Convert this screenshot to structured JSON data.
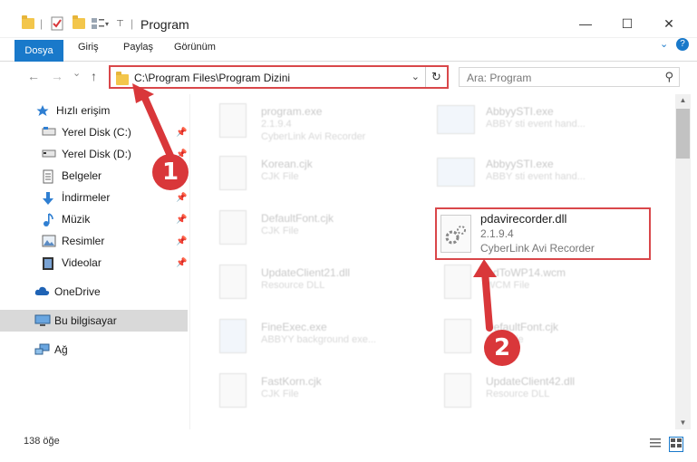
{
  "window": {
    "title": "Program",
    "minimize": "—",
    "maximize": "☐",
    "close": "✕"
  },
  "ribbon": {
    "file": "Dosya",
    "tabs": [
      "Giriş",
      "Paylaş",
      "Görünüm"
    ],
    "help": "?"
  },
  "nav": {
    "back": "←",
    "forward": "→",
    "recent": "⌄",
    "up": "↑",
    "address": "C:\\Program Files\\Program Dizini",
    "address_dropdown": "⌄",
    "refresh": "↻",
    "search_placeholder": "Ara: Program",
    "search_icon": "⚲"
  },
  "sidebar": {
    "items": [
      {
        "label": "Hızlı erişim",
        "icon": "star-icon"
      },
      {
        "label": "Yerel Disk (C:)",
        "icon": "drive-icon",
        "pinned": true
      },
      {
        "label": "Yerel Disk (D:)",
        "icon": "drive-icon",
        "pinned": true
      },
      {
        "label": "Belgeler",
        "icon": "documents-icon",
        "pinned": true
      },
      {
        "label": "İndirmeler",
        "icon": "download-icon",
        "pinned": true
      },
      {
        "label": "Müzik",
        "icon": "music-icon",
        "pinned": true
      },
      {
        "label": "Resimler",
        "icon": "pictures-icon",
        "pinned": true
      },
      {
        "label": "Videolar",
        "icon": "videos-icon",
        "pinned": true
      },
      {
        "label": "OneDrive",
        "icon": "cloud-icon"
      },
      {
        "label": "Bu bilgisayar",
        "icon": "computer-icon",
        "selected": true
      },
      {
        "label": "Ağ",
        "icon": "network-icon"
      }
    ],
    "pin_glyph": "📌"
  },
  "files": {
    "left": [
      {
        "name": "program.exe",
        "sub": "2.1.9.4",
        "sub2": "CyberLink Avi Recorder"
      },
      {
        "name": "Korean.cjk",
        "sub": "CJK File"
      },
      {
        "name": "DefaultFont.cjk",
        "sub": "CJK File"
      },
      {
        "name": "UpdateClient21.dll",
        "sub": "Resource DLL"
      },
      {
        "name": "FineExec.exe",
        "sub": "ABBYY background exe..."
      },
      {
        "name": "FastKorn.cjk",
        "sub": "CJK File"
      }
    ],
    "right": [
      {
        "name": "AbbyySTI.exe",
        "sub": "ABBY sti event hand..."
      },
      {
        "name": "AbbyySTI.exe",
        "sub": "ABBY sti event hand..."
      },
      {
        "name": "AdToWP14.wcm",
        "sub": "WCM File"
      },
      {
        "name": "DefaultFont.cjk",
        "sub": "CJK File"
      },
      {
        "name": "UpdateClient42.dll",
        "sub": "Resource DLL"
      }
    ],
    "highlight": {
      "name": "pdavirecorder.dll",
      "version": "2.1.9.4",
      "description": "CyberLink Avi Recorder"
    }
  },
  "status": {
    "count": "138 öğe"
  },
  "annotations": {
    "step1": "1",
    "step2": "2",
    "color": "#d9373a"
  }
}
